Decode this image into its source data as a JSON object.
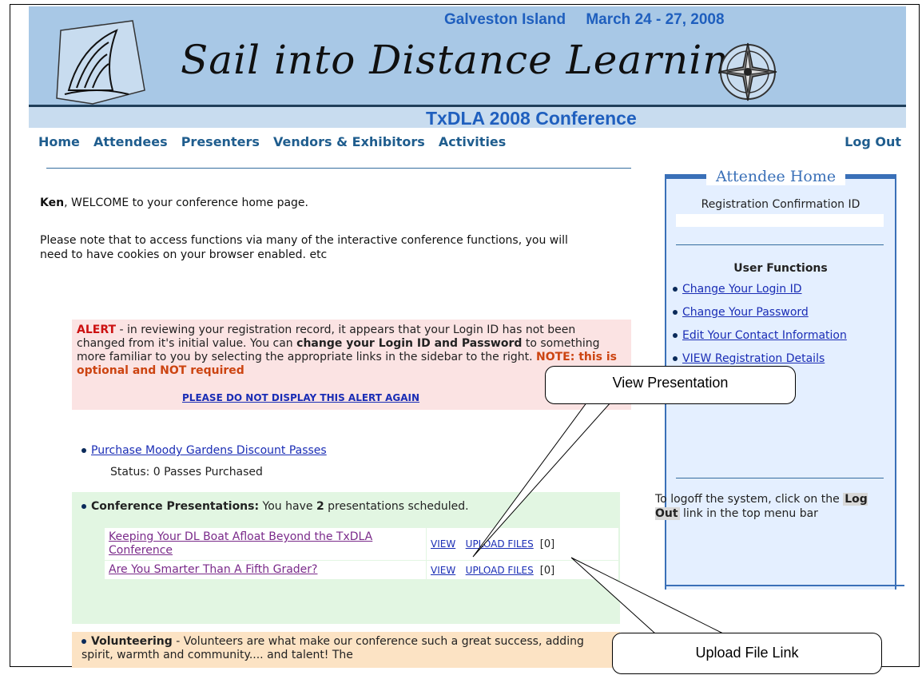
{
  "banner": {
    "location": "Galveston Island",
    "dates": "March 24 - 27, 2008",
    "script_title": "Sail into Distance Learning",
    "subtitle": "TxDLA 2008 Conference"
  },
  "nav": {
    "items": [
      "Home",
      "Attendees",
      "Presenters",
      "Vendors & Exhibitors",
      "Activities"
    ],
    "logout": "Log Out"
  },
  "main": {
    "welcome_name": "Ken",
    "welcome_rest": ", WELCOME to your conference home page.",
    "cookies_note": "Please note that to access functions via many of the interactive conference functions, you will need to have cookies on your browser enabled. etc",
    "alert": {
      "label": "ALERT",
      "text1": " - in reviewing your registration record, it appears that your Login ID has not been changed from it's initial value.  You can ",
      "bold": "change your Login ID and Password",
      "text2": " to something more familiar to you by selecting the appropriate links in the sidebar to the right. ",
      "note": "NOTE: this is optional and NOT required",
      "dismiss": "PLEASE DO NOT DISPLAY THIS ALERT AGAIN"
    },
    "moody_link": "Purchase Moody Gardens Discount Passes",
    "moody_status": "Status: 0 Passes Purchased",
    "presentations": {
      "label": "Conference Presentations:",
      "text_before": " You have ",
      "count": "2",
      "text_after": " presentations scheduled.",
      "rows": [
        {
          "title": "Keeping Your DL Boat Afloat Beyond the TxDLA Conference",
          "view": "VIEW",
          "upload": "UPLOAD FILES",
          "files": "[0]"
        },
        {
          "title": "Are You Smarter Than A Fifth Grader?",
          "view": "VIEW",
          "upload": "UPLOAD FILES",
          "files": "[0]"
        }
      ]
    },
    "volunteer": {
      "label": "Volunteering",
      "text": " - Volunteers are what make our conference such a great success, adding spirit, warmth and community.... and talent! The"
    }
  },
  "sidebar": {
    "title": "Attendee Home",
    "reg_label": "Registration Confirmation  ID",
    "user_functions": "User Functions",
    "links": [
      "Change Your Login ID",
      "Change Your Password",
      "Edit Your Contact Information",
      "VIEW Registration Details"
    ],
    "logoff_text1": "To logoff the system, click on the ",
    "logoff_hl": "Log Out",
    "logoff_text2": " link in the top menu bar"
  },
  "callouts": {
    "view": "View Presentation",
    "upload": "Upload File Link"
  },
  "colors": {
    "banner_bg": "#a8c8e6",
    "nav_text": "#1f5d8e",
    "alert_bg": "#fbe3e3",
    "presentations_bg": "#e2f6e2",
    "volunteer_bg": "#fce3c4",
    "sidebar_bg": "#e4efff",
    "sidebar_border": "#3a70b8"
  }
}
